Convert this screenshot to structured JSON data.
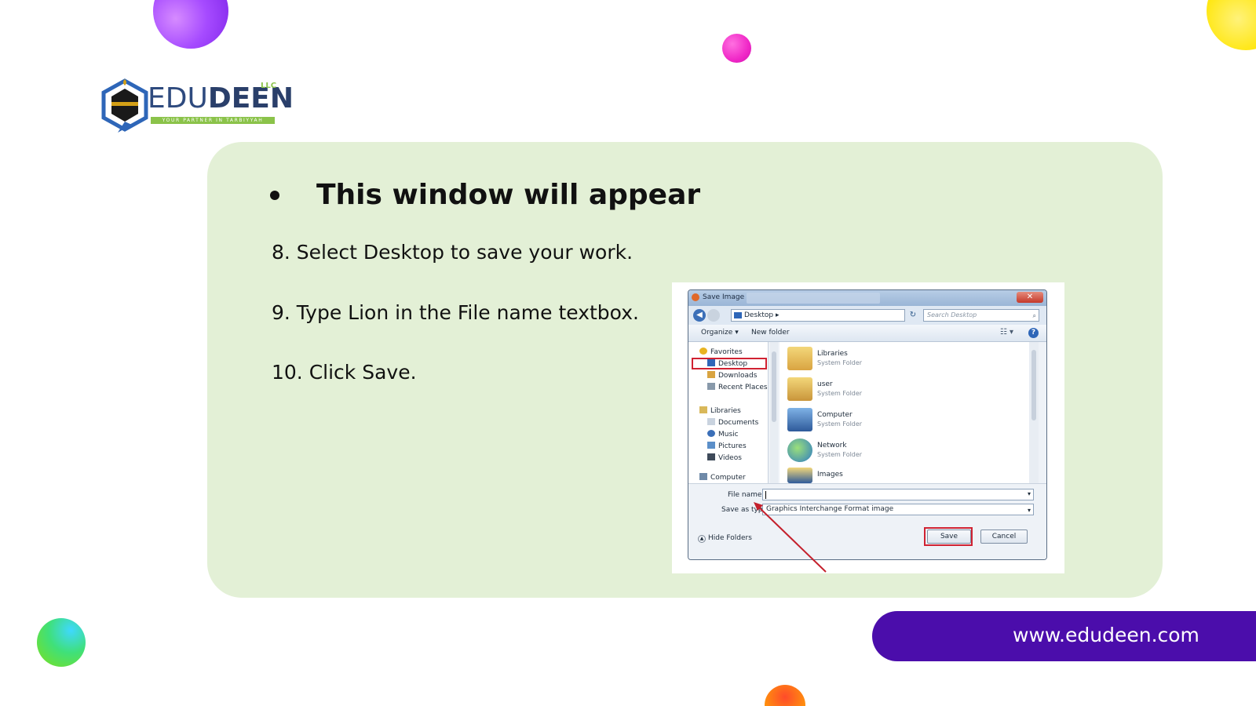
{
  "brand": {
    "name_light": "EDU",
    "name_bold": "DEEN",
    "suffix": "LLC",
    "tagline": "YOUR PARTNER IN TARBIYYAH",
    "website": "www.edudeen.com",
    "colors": {
      "navy": "#2a3f6a",
      "green": "#8bc34a",
      "purple": "#4b0dab",
      "card": "#e3f0d6"
    }
  },
  "slide": {
    "heading": "This window will appear",
    "steps": [
      "8. Select Desktop to save your work.",
      "9. Type Lion in the File name textbox.",
      "10. Click Save."
    ]
  },
  "dialog": {
    "title": "Save Image",
    "address": "Desktop",
    "search_placeholder": "Search Desktop",
    "toolbar": {
      "organize": "Organize",
      "new_folder": "New folder"
    },
    "nav": {
      "favorites": "Favorites",
      "desktop": "Desktop",
      "downloads": "Downloads",
      "recent": "Recent Places",
      "libraries": "Libraries",
      "documents": "Documents",
      "music": "Music",
      "pictures": "Pictures",
      "videos": "Videos",
      "computer": "Computer"
    },
    "items": [
      {
        "name": "Libraries",
        "type": "System Folder",
        "icon": "libraries-folder-icon"
      },
      {
        "name": "user",
        "type": "System Folder",
        "icon": "user-folder-icon"
      },
      {
        "name": "Computer",
        "type": "System Folder",
        "icon": "computer-icon"
      },
      {
        "name": "Network",
        "type": "System Folder",
        "icon": "network-globe-icon"
      },
      {
        "name": "Images",
        "type": "",
        "icon": "images-folder-icon"
      }
    ],
    "file_name_label": "File name:",
    "file_name_value": "",
    "save_type_label": "Save as type:",
    "save_type_value": "Graphics Interchange Format image",
    "hide_folders": "Hide Folders",
    "save_button": "Save",
    "cancel_button": "Cancel",
    "highlight_color": "#d02232"
  }
}
